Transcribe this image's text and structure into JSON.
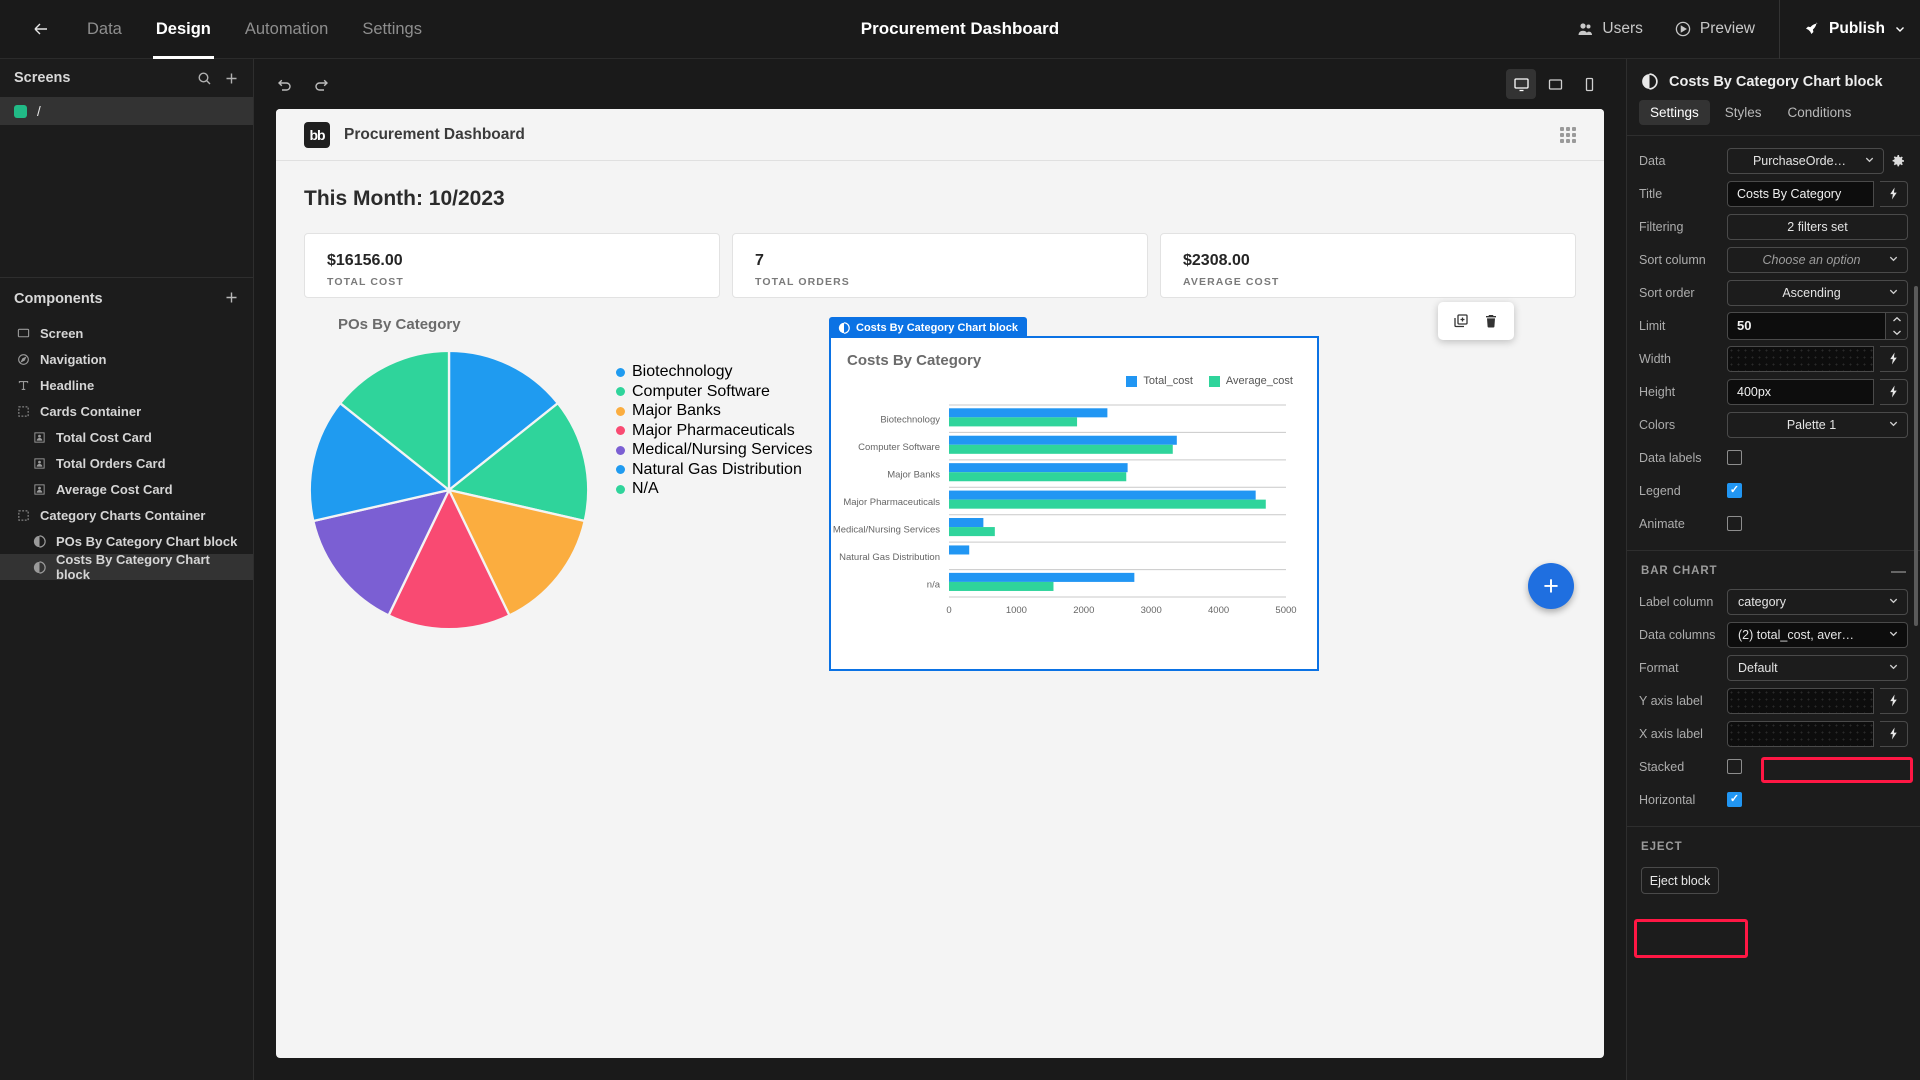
{
  "topbar": {
    "back_icon": "arrow-left-icon",
    "nav": [
      {
        "label": "Data",
        "active": false
      },
      {
        "label": "Design",
        "active": true
      },
      {
        "label": "Automation",
        "active": false
      },
      {
        "label": "Settings",
        "active": false
      }
    ],
    "title": "Procurement Dashboard",
    "users_label": "Users",
    "preview_label": "Preview",
    "publish_label": "Publish"
  },
  "left_panel": {
    "screens_title": "Screens",
    "search_icon": "search-icon",
    "add_icon": "plus-icon",
    "screens": [
      {
        "label": "/",
        "selected": true
      }
    ],
    "components_title": "Components",
    "components_add_icon": "plus-icon",
    "components": [
      {
        "label": "Screen",
        "icon": "screen-icon",
        "indent": 0,
        "selected": false
      },
      {
        "label": "Navigation",
        "icon": "navigation-icon",
        "indent": 0,
        "selected": false
      },
      {
        "label": "Headline",
        "icon": "text-icon",
        "indent": 0,
        "selected": false
      },
      {
        "label": "Cards Container",
        "icon": "container-icon",
        "indent": 0,
        "selected": false
      },
      {
        "label": "Total Cost Card",
        "icon": "card-icon",
        "indent": 1,
        "selected": false
      },
      {
        "label": "Total Orders Card",
        "icon": "card-icon",
        "indent": 1,
        "selected": false
      },
      {
        "label": "Average Cost Card",
        "icon": "card-icon",
        "indent": 1,
        "selected": false
      },
      {
        "label": "Category Charts Container",
        "icon": "container-icon",
        "indent": 0,
        "selected": false
      },
      {
        "label": "POs By Category Chart block",
        "icon": "chart-icon",
        "indent": 1,
        "selected": false
      },
      {
        "label": "Costs By Category Chart block",
        "icon": "chart-icon",
        "indent": 1,
        "selected": true
      }
    ]
  },
  "canvas": {
    "undo_icon": "undo-icon",
    "redo_icon": "redo-icon",
    "devices": [
      {
        "name": "desktop-icon",
        "active": true
      },
      {
        "name": "tablet-icon",
        "active": false
      },
      {
        "name": "mobile-icon",
        "active": false
      }
    ],
    "app_logo": "bb",
    "app_name": "Procurement Dashboard",
    "grip_icon": "drag-grip-icon",
    "headline": "This Month: 10/2023",
    "cards": [
      {
        "value": "$16156.00",
        "label": "TOTAL COST"
      },
      {
        "value": "7",
        "label": "TOTAL ORDERS"
      },
      {
        "value": "$2308.00",
        "label": "AVERAGE COST"
      }
    ],
    "floating_tools": [
      {
        "name": "duplicate-icon"
      },
      {
        "name": "delete-icon"
      }
    ],
    "selected_block_tag": "Costs By Category Chart block",
    "fab_label": "+"
  },
  "chart_data": [
    {
      "type": "pie",
      "title": "POs By Category",
      "legend_position": "right",
      "labels": [
        "Biotechnology",
        "Computer Software",
        "Major Banks",
        "Major Pharmaceuticals",
        "Medical/Nursing Services",
        "Natural Gas Distribution",
        "N/A"
      ],
      "values": [
        1,
        1,
        1,
        1,
        1,
        1,
        1
      ],
      "colors": [
        "#1f9bf0",
        "#2fd49b",
        "#fbad3f",
        "#f94a72",
        "#7b5fd3",
        "#1f9bf0",
        "#2fd49b"
      ]
    },
    {
      "type": "bar",
      "orientation": "horizontal",
      "title": "Costs By Category",
      "categories": [
        "Biotechnology",
        "Computer Software",
        "Major Banks",
        "Major Pharmaceuticals",
        "Medical/Nursing Services",
        "Natural Gas Distribution",
        "n/a"
      ],
      "series": [
        {
          "name": "Total_cost",
          "color": "#2196f3",
          "values": [
            2350,
            3380,
            2650,
            4550,
            510,
            300,
            2750
          ]
        },
        {
          "name": "Average_cost",
          "color": "#2fd49b",
          "values": [
            1900,
            3320,
            2630,
            4700,
            680,
            0,
            1550
          ]
        }
      ],
      "xlabel": "",
      "ylabel": "",
      "xticks": [
        "0",
        "1000",
        "2000",
        "3000",
        "4000",
        "5000"
      ],
      "xlim": [
        0,
        5000
      ],
      "grid": true,
      "legend_position": "top-right"
    }
  ],
  "right_panel": {
    "header_title": "Costs By Category Chart block",
    "header_icon": "chart-icon",
    "tabs": [
      {
        "label": "Settings",
        "active": true
      },
      {
        "label": "Styles",
        "active": false
      },
      {
        "label": "Conditions",
        "active": false
      }
    ],
    "fields": {
      "data_label": "Data",
      "data_value": "PurchaseOrde…",
      "data_gear_icon": "gear-icon",
      "title_label": "Title",
      "title_value": "Costs By Category",
      "filtering_label": "Filtering",
      "filtering_value": "2 filters set",
      "sort_column_label": "Sort column",
      "sort_column_placeholder": "Choose an option",
      "sort_order_label": "Sort order",
      "sort_order_value": "Ascending",
      "limit_label": "Limit",
      "limit_value": "50",
      "width_label": "Width",
      "width_value": "",
      "height_label": "Height",
      "height_value": "400px",
      "colors_label": "Colors",
      "colors_value": "Palette 1",
      "data_labels_label": "Data labels",
      "data_labels_checked": false,
      "legend_label": "Legend",
      "legend_checked": true,
      "animate_label": "Animate",
      "animate_checked": false
    },
    "bar_chart_section": {
      "title": "BAR CHART",
      "minimize_icon": "minus-icon",
      "label_column_label": "Label column",
      "label_column_value": "category",
      "data_columns_label": "Data columns",
      "data_columns_value": "(2) total_cost, aver…",
      "format_label": "Format",
      "format_value": "Default",
      "y_axis_label_label": "Y axis label",
      "y_axis_label_value": "",
      "x_axis_label_label": "X axis label",
      "x_axis_label_value": "",
      "stacked_label": "Stacked",
      "stacked_checked": false,
      "horizontal_label": "Horizontal",
      "horizontal_checked": true
    },
    "eject_section": {
      "title": "EJECT",
      "button_label": "Eject block"
    }
  }
}
